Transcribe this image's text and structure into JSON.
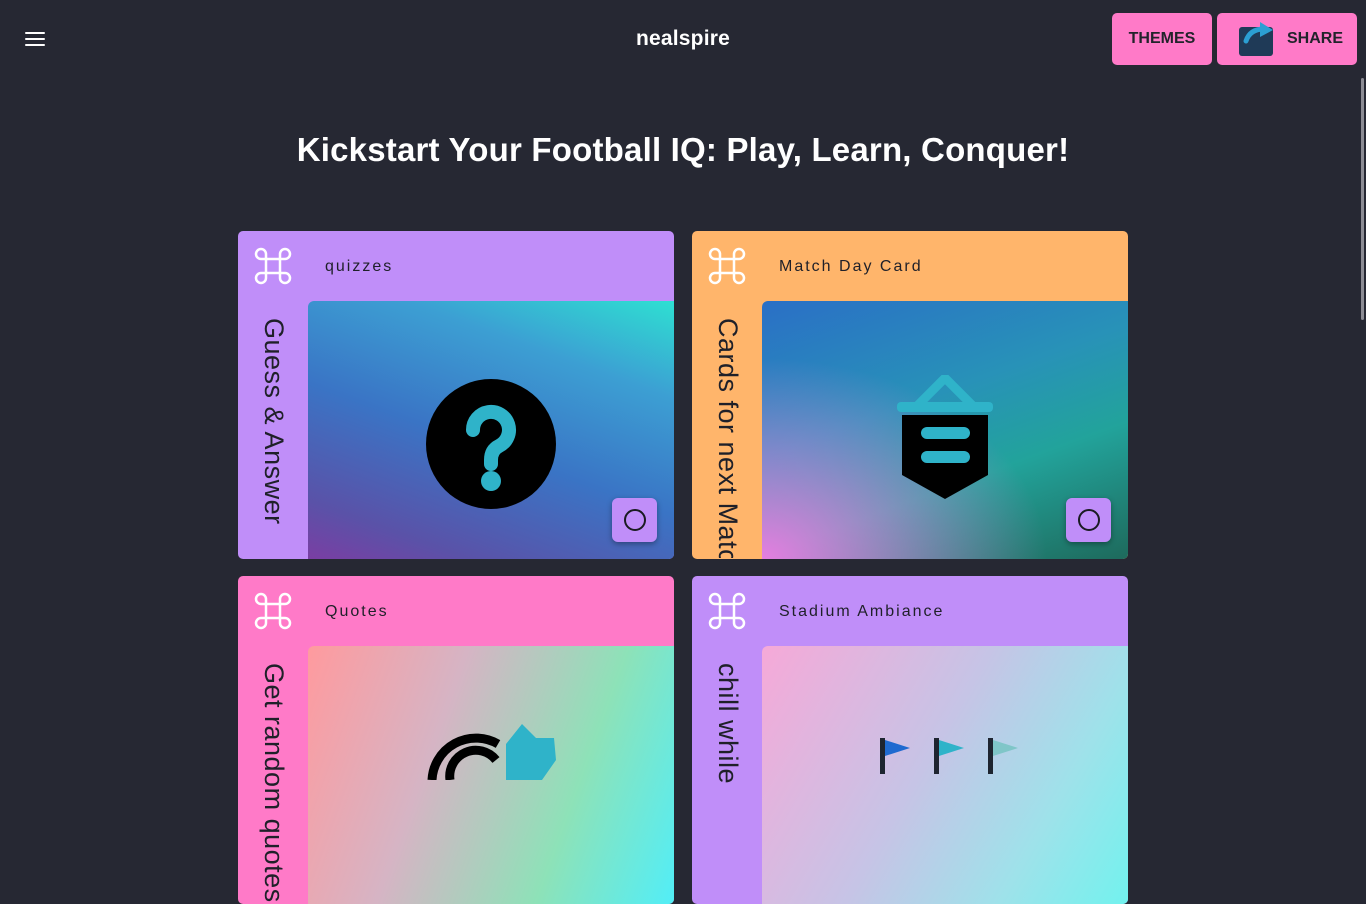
{
  "header": {
    "brand": "nealspire",
    "themes_label": "THEMES",
    "share_label": "SHARE",
    "menu_icon": "hamburger-menu-icon"
  },
  "hero": {
    "title": "Kickstart Your Football IQ: Play, Learn, Conquer!"
  },
  "cards": [
    {
      "category": "quizzes",
      "side_text": "Guess & Answer",
      "icon": "question-circle-icon",
      "accent": "#c08ef9"
    },
    {
      "category": "Match Day Card",
      "side_text": "Cards for next Match",
      "icon": "banner-icon",
      "accent": "#ffb56b"
    },
    {
      "category": "Quotes",
      "side_text": "Get random quotes",
      "icon": "quote-icon",
      "accent": "#ff7ac8"
    },
    {
      "category": "Stadium Ambiance",
      "side_text": "chill while",
      "icon": "flags-icon",
      "accent": "#c08ef9"
    }
  ]
}
